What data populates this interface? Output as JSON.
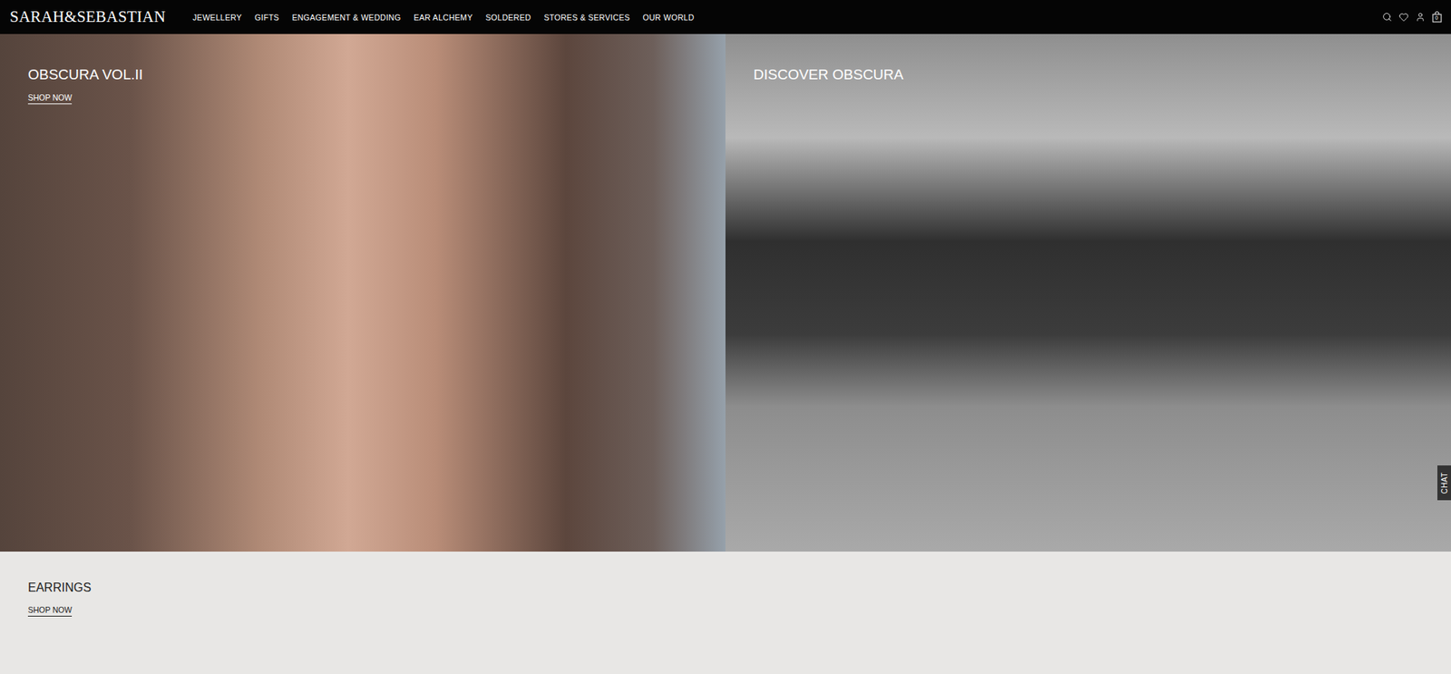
{
  "header": {
    "logo": "SARAH&SEBASTIAN",
    "nav": [
      "JEWELLERY",
      "GIFTS",
      "ENGAGEMENT & WEDDING",
      "EAR ALCHEMY",
      "SOLDERED",
      "STORES & SERVICES",
      "OUR WORLD"
    ],
    "cart_count": "0"
  },
  "hero": [
    {
      "title": "OBSCURA VOL.II",
      "link": "SHOP NOW",
      "kind": "portrait"
    },
    {
      "title": "DISCOVER OBSCURA",
      "link": "",
      "kind": "landscape"
    }
  ],
  "chat": {
    "label": "CHAT"
  },
  "section": {
    "title": "EARRINGS",
    "link": "SHOP NOW"
  }
}
